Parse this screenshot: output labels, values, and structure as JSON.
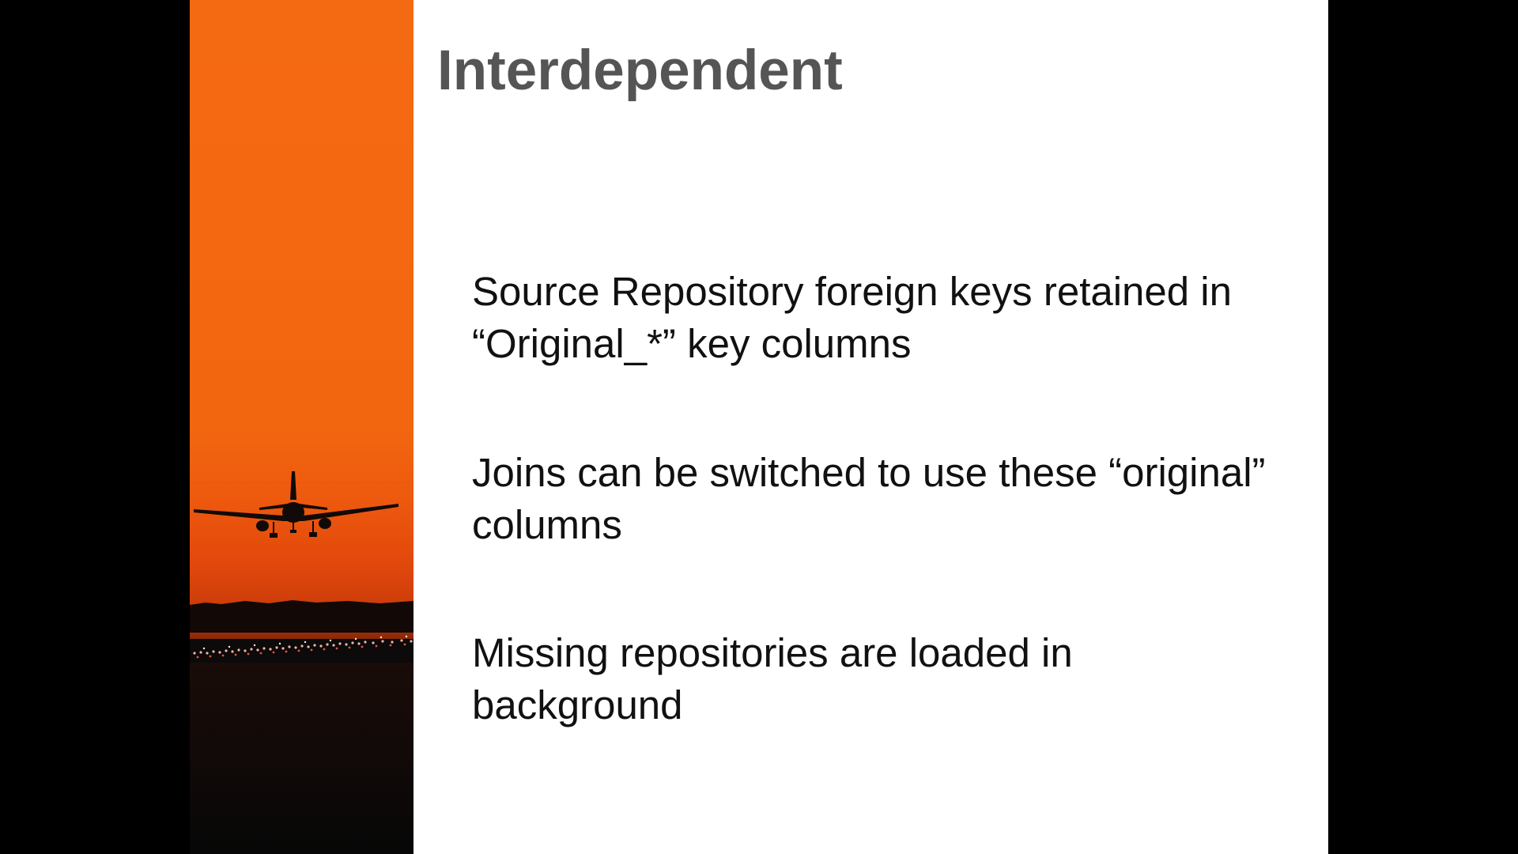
{
  "slide": {
    "title": "Interdependent",
    "bullets": [
      {
        "text": "Source Repository foreign keys retained in “Original_*” key columns"
      },
      {
        "text": "Joins can be switched to use these “original” columns"
      },
      {
        "text": "Missing repositories are loaded in background"
      }
    ]
  },
  "photo": {
    "icon": "airplane-landing-photo"
  },
  "colors": {
    "sky_orange": "#F26A10",
    "horizon_red": "#D8420C",
    "ground_black": "#080808",
    "title_gray": "#555555",
    "body_text": "#111111",
    "letterbox": "#000000",
    "slide_bg": "#FFFFFF"
  }
}
